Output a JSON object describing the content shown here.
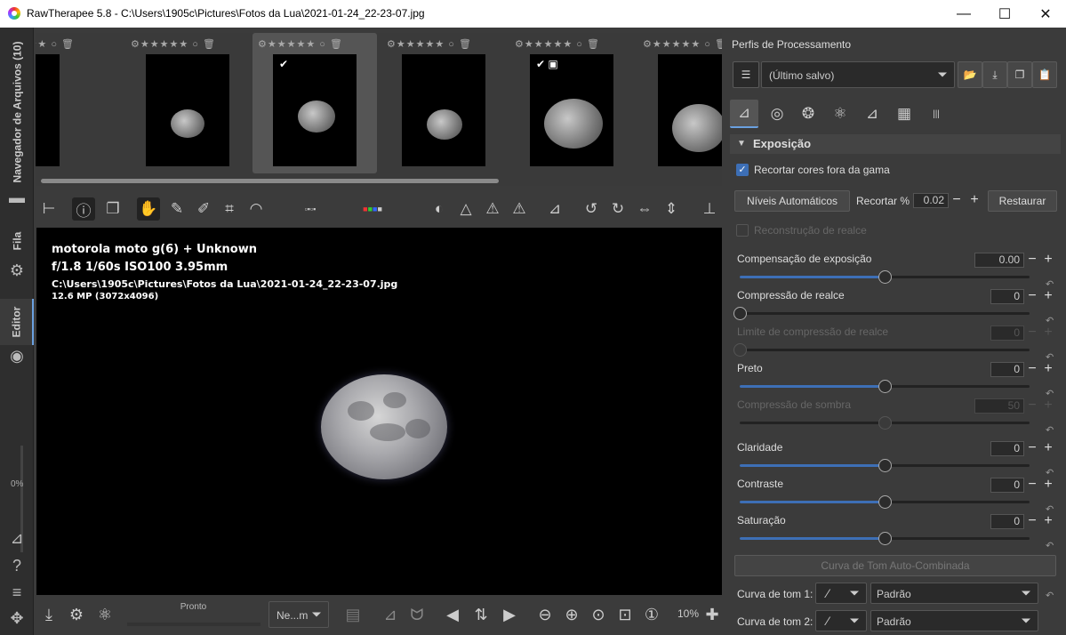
{
  "window": {
    "title": "RawTherapee 5.8 - C:\\Users\\1905c\\Pictures\\Fotos da Lua\\2021-01-24_22-23-07.jpg",
    "minimize": "—",
    "maximize": "☐",
    "close": "✕"
  },
  "sidebar": {
    "tab_file_browser": "Navegador de Arquivos (10)",
    "tab_queue": "Fila",
    "tab_editor": "Editor",
    "progress_label": "0%"
  },
  "filmstrip": {
    "stars": "★★★★★",
    "thumbnails": [
      {
        "name": "thumb-1"
      },
      {
        "name": "thumb-2"
      },
      {
        "name": "thumb-3",
        "selected": true
      },
      {
        "name": "thumb-4"
      },
      {
        "name": "thumb-5"
      },
      {
        "name": "thumb-6"
      }
    ]
  },
  "image_info": {
    "camera": "motorola moto g(6) + Unknown",
    "exposure": "f/1.8  1/60s  ISO100  3.95mm",
    "path": "C:\\Users\\1905c\\Pictures\\Fotos da Lua\\2021-01-24_22-23-07.jpg",
    "resolution": "12.6 MP (3072x4096)"
  },
  "bottombar": {
    "status": "Pronto",
    "preview_mode": "Ne...m",
    "zoom": "10%"
  },
  "right_panel": {
    "profiles_title": "Perfis de Processamento",
    "profile_value": "(Último salvo)",
    "section_title": "Exposição",
    "clip_oog_label": "Recortar cores fora da gama",
    "auto_levels": "Níveis Automáticos",
    "clip_label": "Recortar %",
    "clip_value": "0.02",
    "restore": "Restaurar",
    "highlight_recon": "Reconstrução de realce",
    "sliders": [
      {
        "label": "Compensação de exposição",
        "value": "0.00",
        "pos": 0.5,
        "disabled": false
      },
      {
        "label": "Compressão de realce",
        "value": "0",
        "pos": 0.0,
        "disabled": false
      },
      {
        "label": "Limite de compressão de realce",
        "value": "0",
        "pos": 0.0,
        "disabled": true
      },
      {
        "label": "Preto",
        "value": "0",
        "pos": 0.5,
        "disabled": false
      },
      {
        "label": "Compressão de sombra",
        "value": "50",
        "pos": 0.5,
        "disabled": true
      },
      {
        "label": "Claridade",
        "value": "0",
        "pos": 0.5,
        "disabled": false
      },
      {
        "label": "Contraste",
        "value": "0",
        "pos": 0.5,
        "disabled": false
      },
      {
        "label": "Saturação",
        "value": "0",
        "pos": 0.5,
        "disabled": false
      }
    ],
    "auto_tone_curve": "Curva de Tom Auto-Combinada",
    "tone_curve_1_label": "Curva de tom 1:",
    "tone_curve_1_value": "Padrão",
    "tone_curve_2_label": "Curva de tom 2:",
    "tone_curve_2_value": "Padrão"
  }
}
